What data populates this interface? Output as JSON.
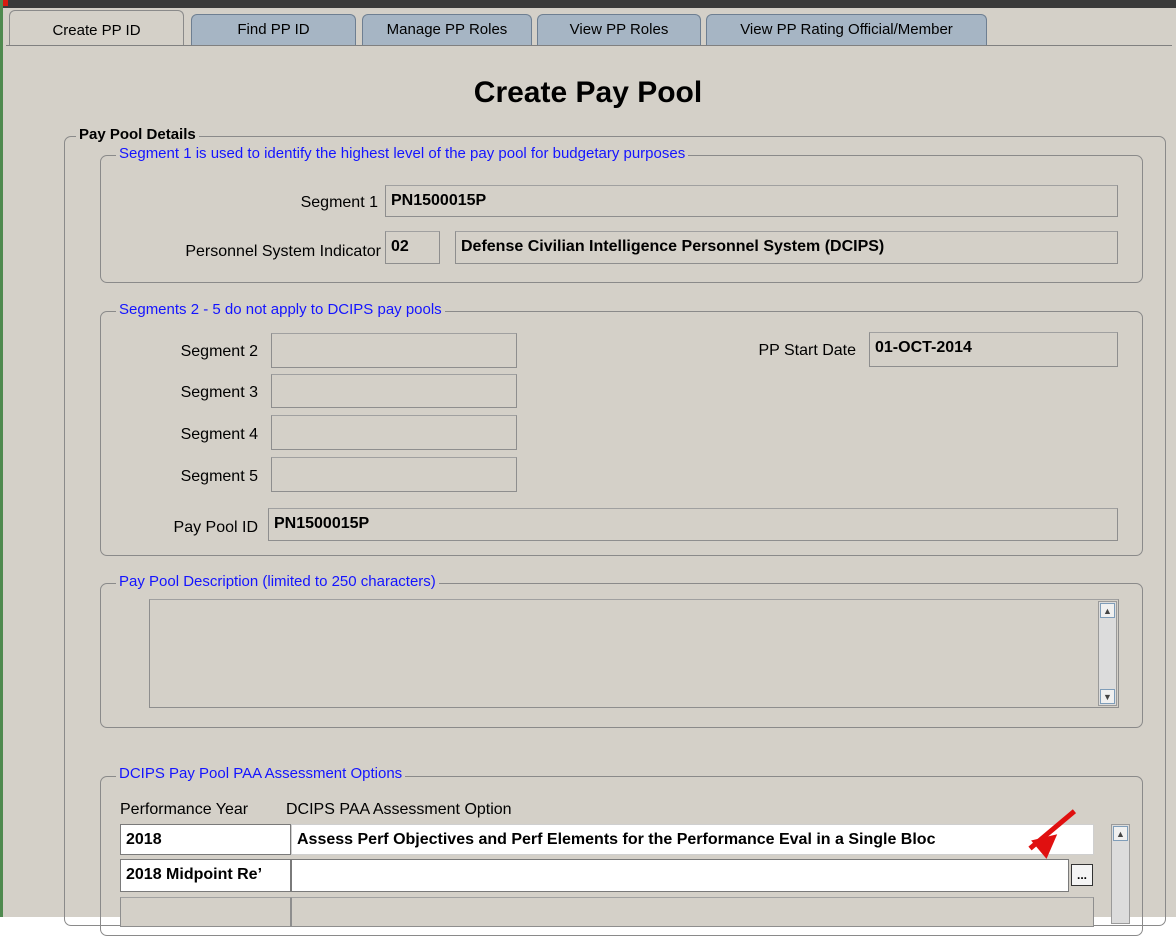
{
  "tabs": [
    "Create PP ID",
    "Find PP ID",
    "Manage PP Roles",
    "View PP Roles",
    "View PP Rating Official/Member"
  ],
  "page_title": "Create Pay Pool",
  "pay_pool_details": {
    "legend": "Pay Pool Details",
    "segment1_group": {
      "legend": "Segment 1 is used to identify the highest level of the pay pool for budgetary purposes",
      "segment1_label": "Segment 1",
      "segment1_value": "PN1500015P",
      "psi_label": "Personnel System Indicator",
      "psi_code": "02",
      "psi_desc": "Defense Civilian Intelligence Personnel System (DCIPS)"
    },
    "segments_group": {
      "legend": "Segments 2 - 5 do not apply to DCIPS pay pools",
      "segment2_label": "Segment 2",
      "segment3_label": "Segment 3",
      "segment4_label": "Segment 4",
      "segment5_label": "Segment 5",
      "start_date_label": "PP Start Date",
      "start_date_value": "01-OCT-2014",
      "pay_pool_id_label": "Pay Pool ID",
      "pay_pool_id_value": "PN1500015P"
    },
    "description_group": {
      "legend": "Pay Pool Description (limited to 250 characters)",
      "value": ""
    },
    "paa_group": {
      "legend": "DCIPS Pay Pool PAA Assessment Options",
      "col_year": "Performance Year",
      "col_option": "DCIPS PAA Assessment Option",
      "rows": [
        {
          "year": "2018",
          "option": "Assess Perf Objectives and Perf Elements for the Performance Eval in a Single Bloc"
        },
        {
          "year": "2018 Midpoint Re’",
          "option": ""
        },
        {
          "year": "",
          "option": ""
        }
      ],
      "ellipsis": "..."
    }
  },
  "colors": {
    "legend_blue": "#1414ff",
    "panel": "#d4d0c8",
    "tab": "#a6b5c4",
    "arrow": "#e01010"
  }
}
